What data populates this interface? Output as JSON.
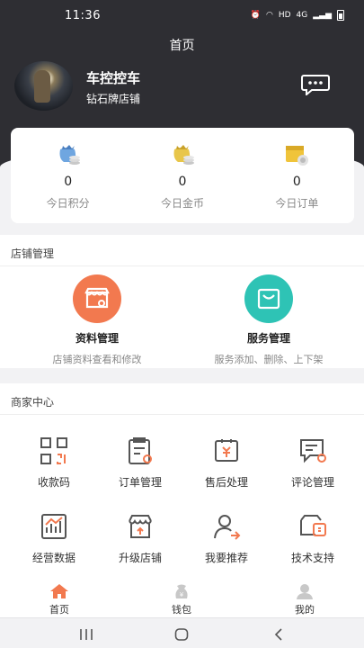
{
  "status_bar": {
    "time": "11:36",
    "indicators": [
      "alarm-icon",
      "wifi-icon",
      "HD",
      "4G",
      "signal-icon",
      "battery-icon"
    ]
  },
  "header": {
    "title": "首页",
    "store_name": "车控控车",
    "store_level": "钻石牌店铺",
    "message_icon": "chat-icon"
  },
  "stats": [
    {
      "icon": "points-coin-icon",
      "value": "0",
      "label": "今日积分"
    },
    {
      "icon": "gold-coin-icon",
      "value": "0",
      "label": "今日金币"
    },
    {
      "icon": "order-box-icon",
      "value": "0",
      "label": "今日订单"
    }
  ],
  "shop_management": {
    "title": "店铺管理",
    "items": [
      {
        "icon": "store-settings-icon",
        "title": "资料管理",
        "desc": "店铺资料查看和修改",
        "color": "#f2794f"
      },
      {
        "icon": "shopping-bag-icon",
        "title": "服务管理",
        "desc": "服务添加、删除、上下架",
        "color": "#2ec3b5"
      }
    ]
  },
  "merchant_center": {
    "title": "商家中心",
    "items": [
      {
        "icon": "qr-code-icon",
        "label": "收款码"
      },
      {
        "icon": "order-list-icon",
        "label": "订单管理"
      },
      {
        "icon": "after-sales-icon",
        "label": "售后处理"
      },
      {
        "icon": "review-icon",
        "label": "评论管理"
      },
      {
        "icon": "chart-icon",
        "label": "经营数据"
      },
      {
        "icon": "upgrade-store-icon",
        "label": "升级店铺"
      },
      {
        "icon": "referral-icon",
        "label": "我要推荐"
      },
      {
        "icon": "support-icon",
        "label": "技术支持"
      }
    ]
  },
  "tabbar": [
    {
      "icon": "home-icon",
      "label": "首页",
      "active": true
    },
    {
      "icon": "wallet-icon",
      "label": "钱包",
      "active": false
    },
    {
      "icon": "profile-icon",
      "label": "我的",
      "active": false
    }
  ],
  "colors": {
    "header_bg": "#2e2e33",
    "accent": "#f2794f",
    "teal": "#2ec3b5",
    "icon_gray": "#555555"
  }
}
